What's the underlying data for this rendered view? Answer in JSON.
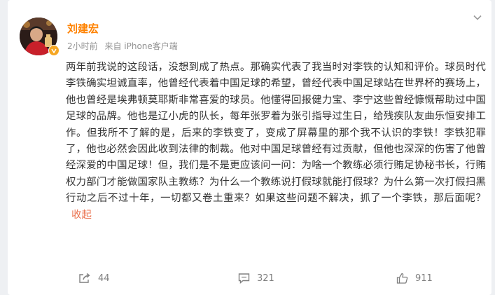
{
  "post": {
    "author": "刘建宏",
    "time": "2小时前",
    "source": "来自 iPhone客户端",
    "text": "两年前我说的这段话，没想到成了热点。那确实代表了我当时对李铁的认知和评价。球员时代李铁确实坦诚直率，他曾经代表着中国足球的希望，曾经代表中国足球站在世界杯的赛场上，他也曾经是埃弗顿莫耶斯非常喜爱的球员。他懂得回报健力宝、李宁这些曾经慷慨帮助过中国足球的品牌。他也是辽小虎的队长，每年张罗着为张引指导过生日，给残疾队友曲乐恒安排工作。但我所不了解的是，后来的李铁变了，变成了屏幕里的那个我不认识的李铁！李铁犯罪了，他也必然会因此收到法律的制裁。他对中国足球曾经有过贡献，但他也深深的伤害了他曾经深爱的中国足球！但，我们是不是更应该问一问：为啥一个教练必须行贿足协秘书长，行贿权力部门才能做国家队主教练？为什么一个教练说打假球就能打假球？为什么第一次打假扫黑行动之后不过十年，一切都又卷土重来？如果这些问题不解决，抓了一个李铁，那后面呢？",
    "collapse_label": "收起"
  },
  "actions": {
    "reposts": "44",
    "comments": "321",
    "likes": "911"
  },
  "colors": {
    "author": "#ff8200",
    "collapse": "#eb7350",
    "meta": "#939393",
    "background": "#eef0f3"
  }
}
